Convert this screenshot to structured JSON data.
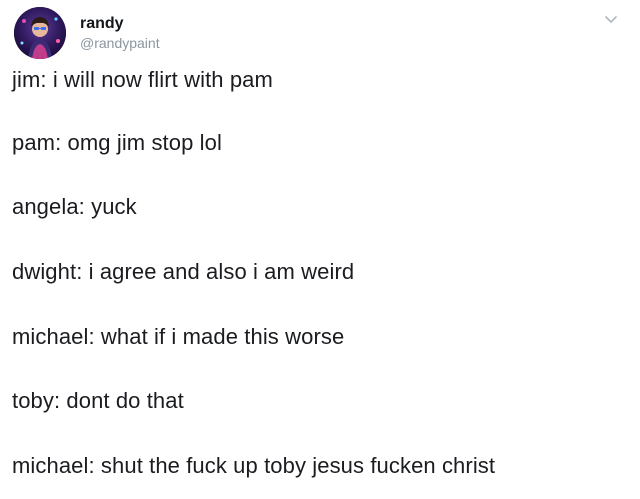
{
  "tweet": {
    "author": {
      "display_name": "randy",
      "handle": "@randypaint",
      "avatar_icon": "avatar-image"
    },
    "menu_icon": "chevron-down-icon",
    "lines": [
      "jim: i will now flirt with pam",
      "pam: omg jim stop lol",
      "angela: yuck",
      "dwight: i agree and also i am weird",
      "michael: what if i made this worse",
      "toby: dont do that",
      "michael: shut the fuck up toby jesus fucken christ"
    ]
  },
  "colors": {
    "background": "#ffffff",
    "text": "#1a1c20",
    "handle": "#8b96a0",
    "chevron": "#b0b8c0"
  }
}
